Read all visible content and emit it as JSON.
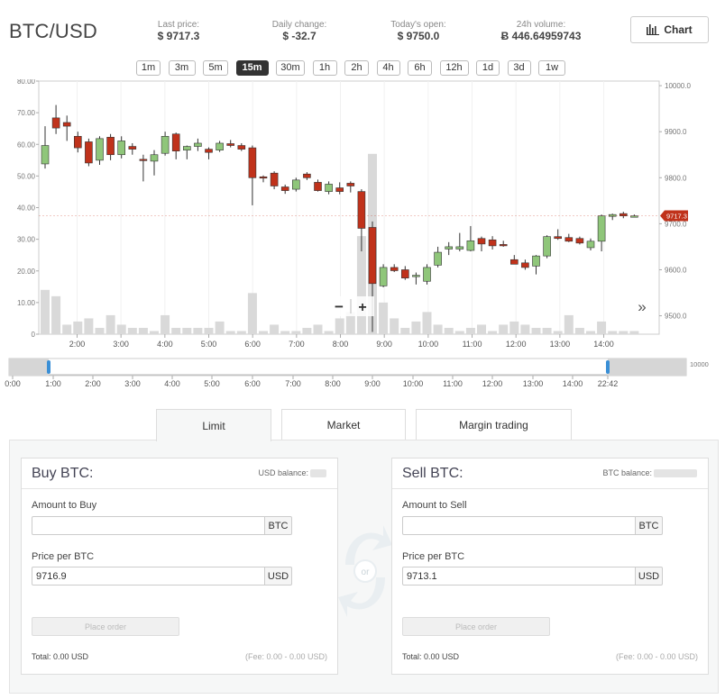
{
  "header": {
    "pair": "BTC/USD",
    "stats": [
      {
        "label": "Last price:",
        "value": "$ 9717.3"
      },
      {
        "label": "Daily change:",
        "value": "$ -32.7"
      },
      {
        "label": "Today's open:",
        "value": "$ 9750.0"
      },
      {
        "label": "24h volume:",
        "value": "Ƀ 446.64959743"
      }
    ],
    "chart_button": "Chart"
  },
  "intervals": {
    "items": [
      "1m",
      "3m",
      "5m",
      "15m",
      "30m",
      "1h",
      "2h",
      "4h",
      "6h",
      "12h",
      "1d",
      "3d",
      "1w"
    ],
    "active": "15m"
  },
  "chart_data": {
    "type": "candlestick",
    "price_axis": {
      "ticks": [
        "9500.0",
        "9600.0",
        "9700.0",
        "9800.0",
        "9900.0",
        "10000.0"
      ],
      "range": [
        9460,
        10010
      ]
    },
    "volume_axis": {
      "ticks": [
        "0",
        "10.00",
        "20.00",
        "30.00",
        "40.00",
        "50.00",
        "60.00",
        "70.00",
        "80.00"
      ],
      "range": [
        0,
        80
      ]
    },
    "x_labels": [
      "2:00",
      "3:00",
      "4:00",
      "5:00",
      "6:00",
      "7:00",
      "8:00",
      "9:00",
      "10:00",
      "11:00",
      "12:00",
      "13:00",
      "14:00"
    ],
    "last_price_label": "9717.3",
    "colors": {
      "up": "#8fc67a",
      "down": "#c0321b",
      "volume": "#d9d9d9"
    },
    "candles": [
      {
        "o": 9830,
        "h": 9912,
        "l": 9820,
        "c": 9870,
        "v": 14
      },
      {
        "o": 9930,
        "h": 9958,
        "l": 9895,
        "c": 9908,
        "v": 12
      },
      {
        "o": 9920,
        "h": 9935,
        "l": 9880,
        "c": 9912,
        "v": 3
      },
      {
        "o": 9890,
        "h": 9900,
        "l": 9855,
        "c": 9865,
        "v": 4
      },
      {
        "o": 9878,
        "h": 9885,
        "l": 9825,
        "c": 9832,
        "v": 5
      },
      {
        "o": 9838,
        "h": 9890,
        "l": 9828,
        "c": 9885,
        "v": 2
      },
      {
        "o": 9888,
        "h": 9895,
        "l": 9838,
        "c": 9850,
        "v": 6
      },
      {
        "o": 9850,
        "h": 9890,
        "l": 9842,
        "c": 9880,
        "v": 3
      },
      {
        "o": 9868,
        "h": 9875,
        "l": 9850,
        "c": 9862,
        "v": 2
      },
      {
        "o": 9840,
        "h": 9850,
        "l": 9792,
        "c": 9838,
        "v": 2
      },
      {
        "o": 9836,
        "h": 9860,
        "l": 9805,
        "c": 9850,
        "v": 1
      },
      {
        "o": 9853,
        "h": 9900,
        "l": 9848,
        "c": 9890,
        "v": 6
      },
      {
        "o": 9895,
        "h": 9898,
        "l": 9840,
        "c": 9858,
        "v": 2
      },
      {
        "o": 9860,
        "h": 9870,
        "l": 9840,
        "c": 9868,
        "v": 2
      },
      {
        "o": 9868,
        "h": 9885,
        "l": 9858,
        "c": 9875,
        "v": 2
      },
      {
        "o": 9862,
        "h": 9866,
        "l": 9840,
        "c": 9855,
        "v": 2
      },
      {
        "o": 9860,
        "h": 9880,
        "l": 9856,
        "c": 9875,
        "v": 4
      },
      {
        "o": 9874,
        "h": 9882,
        "l": 9866,
        "c": 9870,
        "v": 1
      },
      {
        "o": 9870,
        "h": 9875,
        "l": 9858,
        "c": 9862,
        "v": 1
      },
      {
        "o": 9865,
        "h": 9870,
        "l": 9740,
        "c": 9800,
        "v": 13
      },
      {
        "o": 9802,
        "h": 9805,
        "l": 9790,
        "c": 9800,
        "v": 1
      },
      {
        "o": 9810,
        "h": 9814,
        "l": 9775,
        "c": 9782,
        "v": 3
      },
      {
        "o": 9780,
        "h": 9785,
        "l": 9765,
        "c": 9772,
        "v": 1
      },
      {
        "o": 9775,
        "h": 9800,
        "l": 9770,
        "c": 9795,
        "v": 1
      },
      {
        "o": 9808,
        "h": 9812,
        "l": 9795,
        "c": 9800,
        "v": 2
      },
      {
        "o": 9790,
        "h": 9796,
        "l": 9770,
        "c": 9772,
        "v": 3
      },
      {
        "o": 9770,
        "h": 9792,
        "l": 9764,
        "c": 9786,
        "v": 1
      },
      {
        "o": 9778,
        "h": 9790,
        "l": 9764,
        "c": 9770,
        "v": 5
      },
      {
        "o": 9788,
        "h": 9792,
        "l": 9768,
        "c": 9782,
        "v": 7
      },
      {
        "o": 9770,
        "h": 9775,
        "l": 9640,
        "c": 9690,
        "v": 31
      },
      {
        "o": 9692,
        "h": 9705,
        "l": 9465,
        "c": 9570,
        "v": 57
      },
      {
        "o": 9565,
        "h": 9612,
        "l": 9562,
        "c": 9605,
        "v": 10
      },
      {
        "o": 9605,
        "h": 9612,
        "l": 9595,
        "c": 9598,
        "v": 5
      },
      {
        "o": 9600,
        "h": 9608,
        "l": 9578,
        "c": 9582,
        "v": 2
      },
      {
        "o": 9585,
        "h": 9594,
        "l": 9568,
        "c": 9588,
        "v": 4
      },
      {
        "o": 9575,
        "h": 9612,
        "l": 9568,
        "c": 9605,
        "v": 7
      },
      {
        "o": 9610,
        "h": 9650,
        "l": 9605,
        "c": 9638,
        "v": 3
      },
      {
        "o": 9645,
        "h": 9660,
        "l": 9632,
        "c": 9650,
        "v": 2
      },
      {
        "o": 9645,
        "h": 9680,
        "l": 9640,
        "c": 9650,
        "v": 1
      },
      {
        "o": 9642,
        "h": 9695,
        "l": 9640,
        "c": 9663,
        "v": 2
      },
      {
        "o": 9668,
        "h": 9672,
        "l": 9640,
        "c": 9656,
        "v": 3
      },
      {
        "o": 9665,
        "h": 9673,
        "l": 9644,
        "c": 9652,
        "v": 1
      },
      {
        "o": 9655,
        "h": 9663,
        "l": 9650,
        "c": 9652,
        "v": 3
      },
      {
        "o": 9622,
        "h": 9632,
        "l": 9612,
        "c": 9612,
        "v": 4
      },
      {
        "o": 9615,
        "h": 9622,
        "l": 9600,
        "c": 9605,
        "v": 3
      },
      {
        "o": 9608,
        "h": 9632,
        "l": 9590,
        "c": 9630,
        "v": 2
      },
      {
        "o": 9630,
        "h": 9675,
        "l": 9625,
        "c": 9672,
        "v": 2
      },
      {
        "o": 9672,
        "h": 9688,
        "l": 9665,
        "c": 9668,
        "v": 1
      },
      {
        "o": 9670,
        "h": 9678,
        "l": 9660,
        "c": 9662,
        "v": 6
      },
      {
        "o": 9668,
        "h": 9672,
        "l": 9655,
        "c": 9658,
        "v": 2
      },
      {
        "o": 9648,
        "h": 9668,
        "l": 9642,
        "c": 9662,
        "v": 1
      },
      {
        "o": 9662,
        "h": 9720,
        "l": 9640,
        "c": 9717,
        "v": 4
      },
      {
        "o": 9716,
        "h": 9722,
        "l": 9708,
        "c": 9720,
        "v": 1
      },
      {
        "o": 9722,
        "h": 9726,
        "l": 9712,
        "c": 9717,
        "v": 1
      },
      {
        "o": 9716,
        "h": 9720,
        "l": 9714,
        "c": 9717,
        "v": 1
      }
    ]
  },
  "zoom": {
    "minus": "−",
    "plus": "+",
    "scroll_end": "»"
  },
  "navigator": {
    "labels": [
      "0:00",
      "1:00",
      "2:00",
      "3:00",
      "4:00",
      "5:00",
      "6:00",
      "7:00",
      "8:00",
      "9:00",
      "10:00",
      "11:00",
      "12:00",
      "13:00",
      "14:00",
      "22:42"
    ],
    "right_label": "10000"
  },
  "order_tabs": {
    "items": [
      "Limit",
      "Market",
      "Margin trading"
    ],
    "active": "Limit"
  },
  "buy": {
    "title": "Buy BTC:",
    "balance_label": "USD balance:",
    "amount_label": "Amount to Buy",
    "amount_value": "",
    "amount_unit": "BTC",
    "price_label": "Price per BTC",
    "price_value": "9716.9",
    "price_unit": "USD",
    "button": "Place order",
    "total": "Total: 0.00 USD",
    "fee": "(Fee: 0.00 - 0.00 USD)"
  },
  "swap": {
    "label": "or"
  },
  "sell": {
    "title": "Sell BTC:",
    "balance_label": "BTC balance:",
    "amount_label": "Amount to Sell",
    "amount_value": "",
    "amount_unit": "BTC",
    "price_label": "Price per BTC",
    "price_value": "9713.1",
    "price_unit": "USD",
    "button": "Place order",
    "total": "Total: 0.00 USD",
    "fee": "(Fee: 0.00 - 0.00 USD)"
  }
}
